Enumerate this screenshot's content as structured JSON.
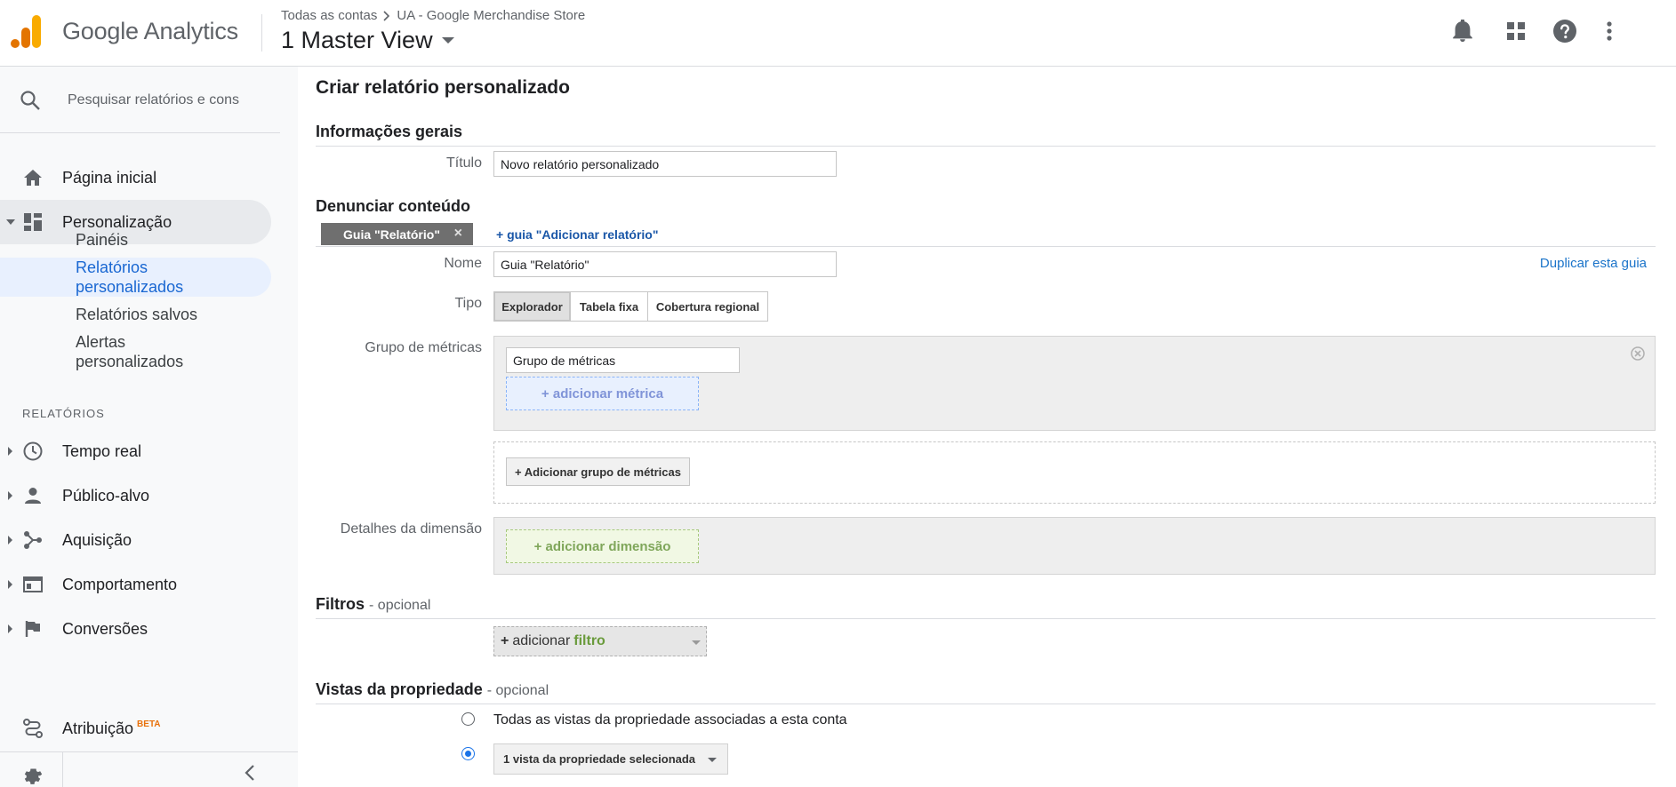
{
  "header": {
    "brand": "Google Analytics",
    "breadcrumb": [
      "Todas as contas",
      "UA - Google Merchandise Store"
    ],
    "breadcrumb_separator": ">",
    "view": "1 Master View",
    "icons": [
      "notifications-icon",
      "apps-grid-icon",
      "help-icon",
      "more-vert-icon"
    ],
    "logo_colors": [
      "#f9ab00",
      "#e37400",
      "#e37400"
    ]
  },
  "sidebar": {
    "search_placeholder": "Pesquisar relatórios e cons",
    "home": "Página inicial",
    "customization": {
      "label": "Personalização",
      "children": [
        "Painéis",
        "Relatórios personalizados",
        "Relatórios salvos",
        "Alertas personalizados"
      ]
    },
    "reports_section": "RELATÓRIOS",
    "reports": [
      "Tempo real",
      "Público-alvo",
      "Aquisição",
      "Comportamento",
      "Conversões"
    ],
    "attribution": "Atribuição",
    "attribution_badge": "BETA"
  },
  "form": {
    "page_title": "Criar relatório personalizado",
    "general_section": "Informações gerais",
    "title_label": "Título",
    "title_value": "Novo relatório personalizado",
    "content_section": "Denunciar conteúdo",
    "tab_name": "Guia \"Relatório\"",
    "tab_close": "×",
    "add_tab": "+ guia \"Adicionar relatório\"",
    "duplicate_tab": "Duplicar esta guia",
    "name_label": "Nome",
    "name_value": "Guia \"Relatório\"",
    "type_label": "Tipo",
    "types": [
      "Explorador",
      "Tabela fixa",
      "Cobertura regional"
    ],
    "selected_type": "Explorador",
    "metric_group_label": "Grupo de métricas",
    "metric_group_value": "Grupo de métricas",
    "add_metric": "+ adicionar métrica",
    "add_metric_group": "+ Adicionar grupo de métricas",
    "dimension_label": "Detalhes da dimensão",
    "add_dimension": "+ adicionar dimensão",
    "filters_section": "Filtros",
    "optional_text": "- opcional",
    "filter_plus": "+",
    "filter_text": "adicionar",
    "filter_keyword": "filtro",
    "views_section": "Vistas da propriedade",
    "view_option_all": "Todas as vistas da propriedade associadas a esta conta",
    "view_option_selected": "1 vista da propriedade selecionada",
    "selected_view_option": 2
  }
}
